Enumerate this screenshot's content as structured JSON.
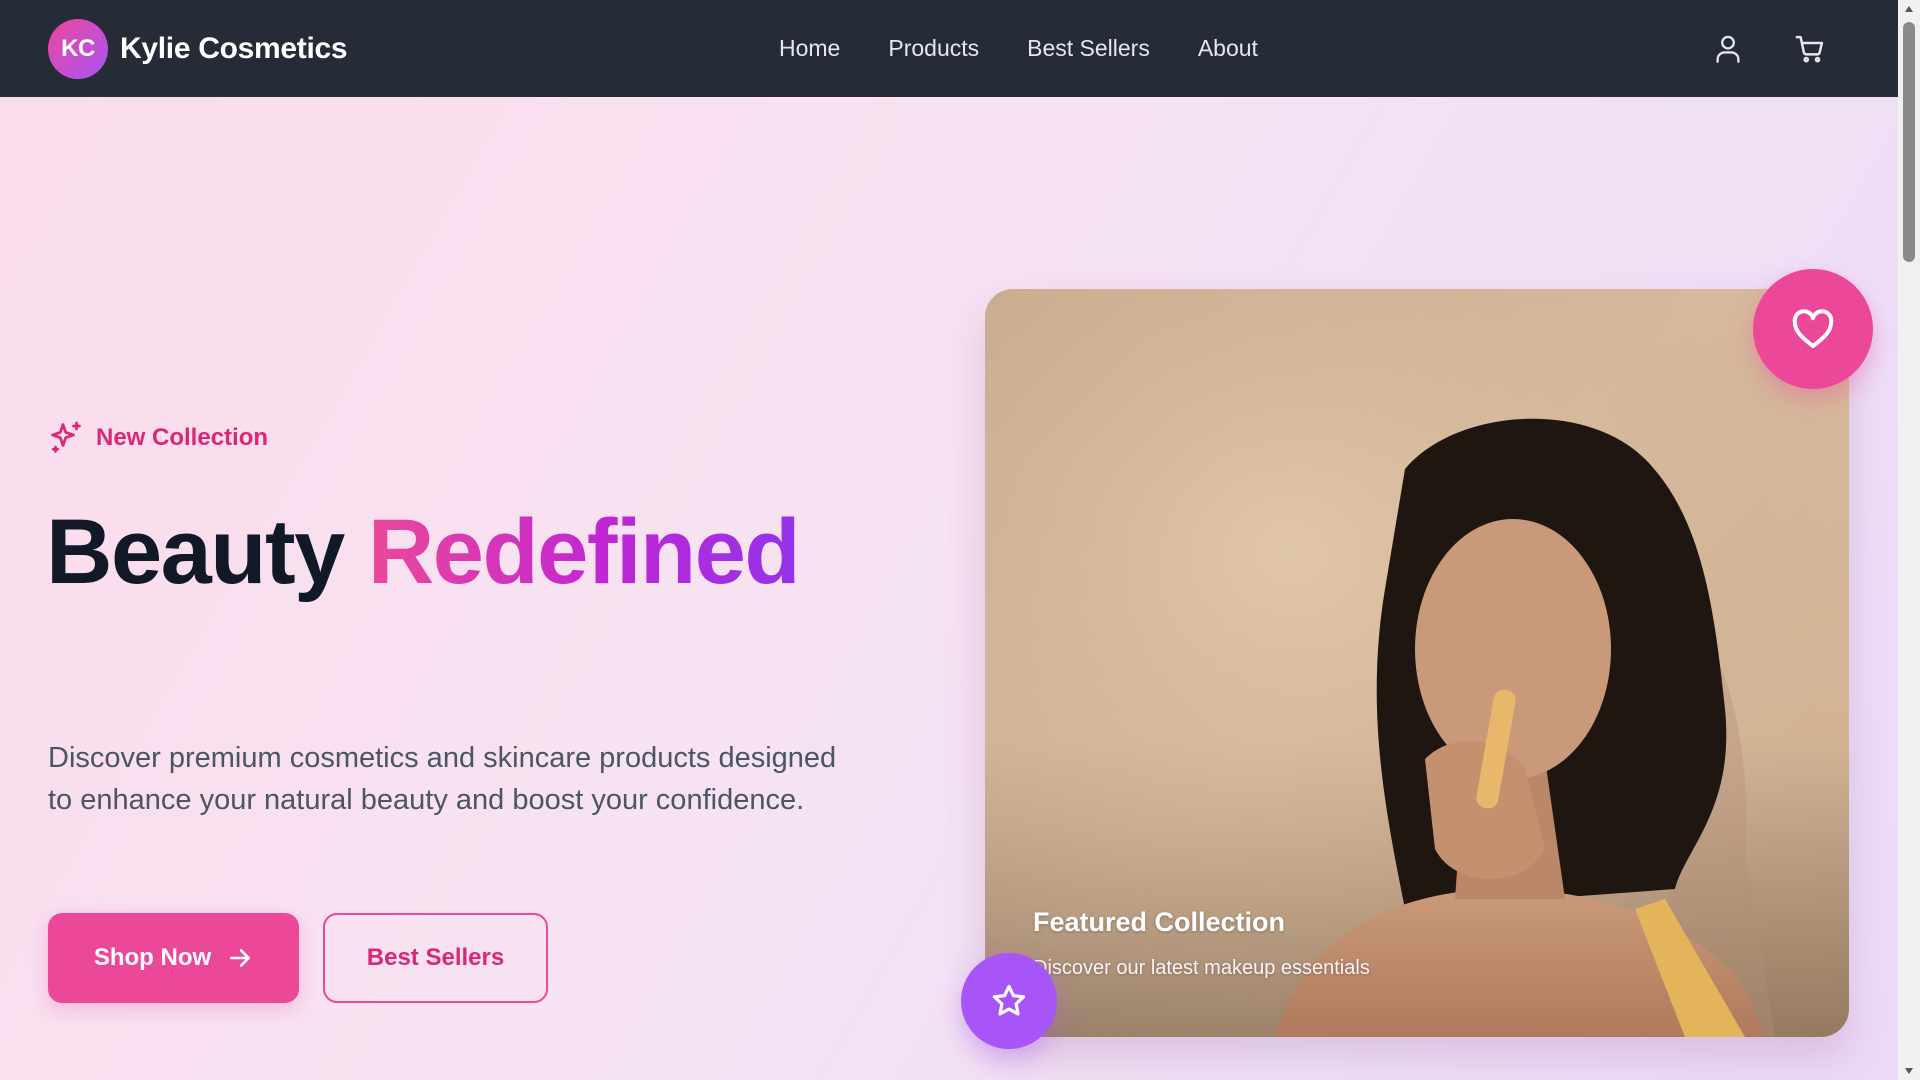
{
  "nav": {
    "logo_initials": "KC",
    "brand_name": "Kylie Cosmetics",
    "links": [
      {
        "label": "Home"
      },
      {
        "label": "Products"
      },
      {
        "label": "Best Sellers"
      },
      {
        "label": "About"
      }
    ],
    "icons": [
      "user-icon",
      "cart-icon"
    ]
  },
  "hero": {
    "tag_icon": "sparkles-icon",
    "tag_label": "New Collection",
    "headline_part1": "Beauty",
    "headline_part2": "Redefined",
    "description": "Discover premium cosmetics and skincare products designed to enhance your natural beauty and boost your confidence.",
    "primary_button": "Shop Now",
    "primary_button_icon": "arrow-right-icon",
    "secondary_button": "Best Sellers"
  },
  "feature_card": {
    "title": "Featured Collection",
    "subtitle": "Discover our latest makeup essentials",
    "image_description_icon": "model-photo",
    "heart_icon": "heart-icon",
    "star_icon": "star-icon"
  },
  "colors": {
    "nav_bg": "#252b37",
    "accent_pink": "#ec4899",
    "accent_purple": "#a855f7",
    "headline_dark": "#111827",
    "body_text": "#4b5563"
  }
}
